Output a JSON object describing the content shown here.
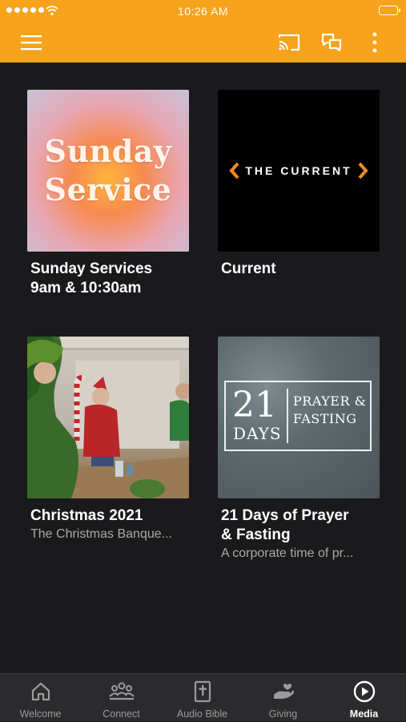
{
  "status_bar": {
    "time": "10:26 AM"
  },
  "header": {
    "menu_icon": "hamburger-icon",
    "actions": [
      "cast-icon",
      "chat-icon",
      "more-vertical-icon"
    ]
  },
  "media_items": [
    {
      "title": "Sunday Services\n9am & 10:30am",
      "subtitle": "",
      "thumbnail": {
        "line1": "Sunday",
        "line2": "Service"
      }
    },
    {
      "title": "Current",
      "subtitle": "",
      "thumbnail": {
        "text": "THE CURRENT"
      }
    },
    {
      "title": "Christmas 2021",
      "subtitle": "The Christmas Banque...",
      "thumbnail": {
        "kind": "photo"
      }
    },
    {
      "title": "21 Days of Prayer\n& Fasting",
      "subtitle": "A corporate time of pr...",
      "thumbnail": {
        "number": "21",
        "days": "DAYS",
        "line1": "PRAYER &",
        "line2": "FASTING"
      }
    }
  ],
  "tabs": [
    {
      "label": "Welcome",
      "icon": "home-icon"
    },
    {
      "label": "Connect",
      "icon": "people-icon"
    },
    {
      "label": "Audio Bible",
      "icon": "bible-icon"
    },
    {
      "label": "Giving",
      "icon": "giving-hand-icon"
    },
    {
      "label": "Media",
      "icon": "play-circle-icon",
      "active": true
    }
  ],
  "colors": {
    "accent": "#f7a21b",
    "background": "#1a1a1c",
    "tab_bar": "#2b2b2d",
    "current_arrow": "#f08a24"
  }
}
